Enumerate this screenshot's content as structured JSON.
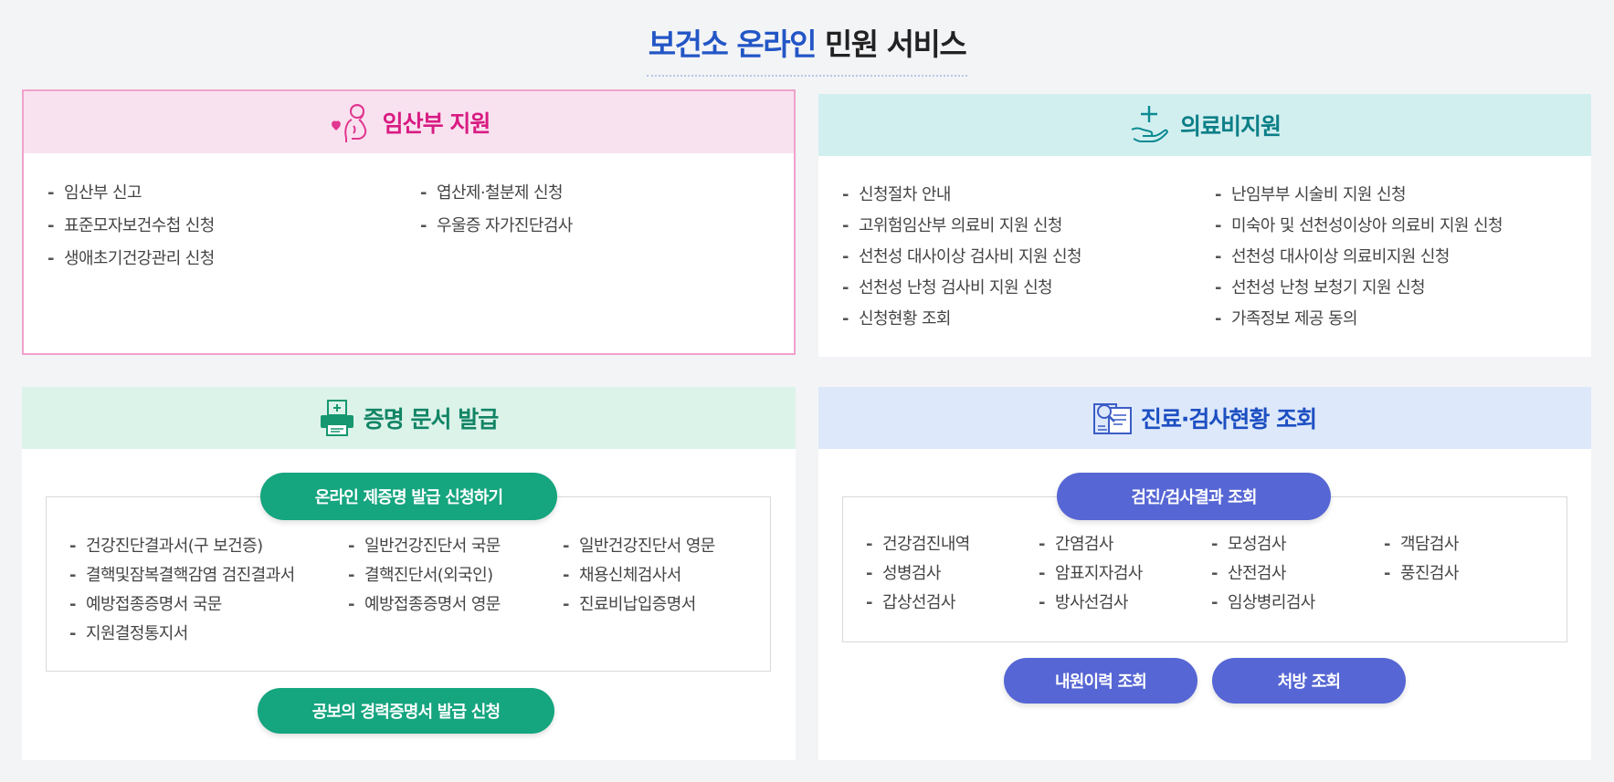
{
  "title": {
    "accent": "보건소 온라인",
    "rest": " 민원 서비스"
  },
  "pregnant": {
    "title": "임산부 지원",
    "items": [
      "임산부 신고",
      "표준모자보건수첩 신청",
      "생애초기건강관리 신청",
      "엽산제·철분제 신청",
      "우울증 자가진단검사"
    ]
  },
  "medical": {
    "title": "의료비지원",
    "items": [
      "신청절차 안내",
      "고위험임산부 의료비 지원 신청",
      "선천성 대사이상 검사비 지원 신청",
      "선천성 난청 검사비 지원 신청",
      "신청현황 조회",
      "난임부부 시술비 지원 신청",
      "미숙아 및 선천성이상아 의료비 지원 신청",
      "선천성 대사이상 의료비지원 신청",
      "선천성 난청 보청기 지원 신청",
      "가족정보 제공 동의"
    ]
  },
  "cert": {
    "title": "증명 문서 발급",
    "apply_button": "온라인 제증명 발급 신청하기",
    "items": [
      "건강진단결과서(구 보건증)",
      "일반건강진단서 국문",
      "일반건강진단서 영문",
      "결핵및잠복결핵감염 검진결과서",
      "결핵진단서(외국인)",
      "채용신체검사서",
      "예방접종증명서 국문",
      "예방접종증명서 영문",
      "진료비납입증명서",
      "지원결정통지서"
    ],
    "career_button": "공보의 경력증명서 발급 신청"
  },
  "check": {
    "title": "진료·검사현황 조회",
    "result_button": "검진/검사결과 조회",
    "items": [
      "건강검진내역",
      "간염검사",
      "모성검사",
      "객담검사",
      "성병검사",
      "암표지자검사",
      "산전검사",
      "풍진검사",
      "갑상선검사",
      "방사선검사",
      "임상병리검사"
    ],
    "visit_button": "내원이력 조회",
    "prescription_button": "처방 조회"
  },
  "colors": {
    "pink": "#d81b82",
    "teal": "#0c7f87",
    "green": "#128565",
    "blue": "#1d4fc2",
    "green_button": "#15a57f",
    "blue_button": "#5666d4"
  },
  "icons": [
    "pregnant-woman-icon",
    "hand-plus-icon",
    "printer-icon",
    "document-search-icon"
  ]
}
